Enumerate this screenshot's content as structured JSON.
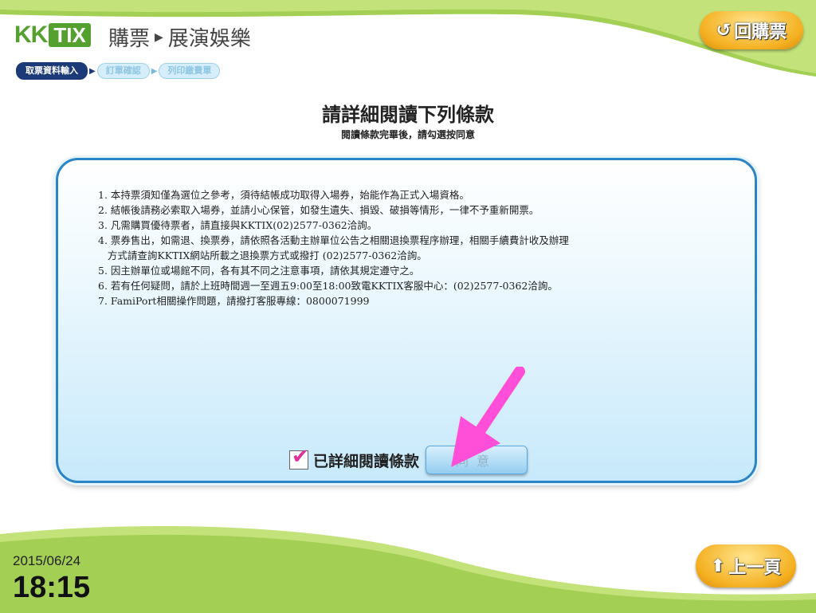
{
  "header": {
    "logo_kk": "KK",
    "logo_tix": "TIX",
    "breadcrumb": [
      "購票",
      "展演娛樂"
    ],
    "back_label": "回購票"
  },
  "steps": [
    "取票資料輸入",
    "訂單確認",
    "列印繳費單"
  ],
  "page": {
    "title": "請詳細閱讀下列條款",
    "subtitle": "閱讀條款完畢後，請勾選按同意"
  },
  "terms": [
    "1. 本持票須知僅為選位之參考，須待結帳成功取得入場券，始能作為正式入場資格。",
    "2. 結帳後請務必索取入場券，並請小心保管，如發生遺失、損毀、破損等情形，一律不予重新開票。",
    "3. 凡需購買優待票者，請直接與KKTIX(02)2577-0362洽詢。",
    "4. 票券售出，如需退、換票券，請依照各活動主辦單位公告之相關退換票程序辦理，相關手續費計收及辦理\n   方式請查詢KKTIX網站所載之退換票方式或撥打 (02)2577-0362洽詢。",
    "5. 因主辦單位或場館不同，各有其不同之注意事項，請依其規定遵守之。",
    "6. 若有任何疑問，請於上班時間週一至週五9:00至18:00致電KKTIX客服中心：(02)2577-0362洽詢。",
    "7. FamiPort相關操作問題，請撥打客服專線：0800071999"
  ],
  "agree": {
    "checked": true,
    "label": "已詳細閱讀條款",
    "button_label": "同意"
  },
  "footer": {
    "date": "2015/06/24",
    "time": "18:15",
    "prev_label": "上一頁"
  },
  "colors": {
    "brand_green": "#55a12f",
    "panel_border": "#2b84c6",
    "pointer": "#ff4fd8",
    "button_gold": "#f4b020"
  }
}
